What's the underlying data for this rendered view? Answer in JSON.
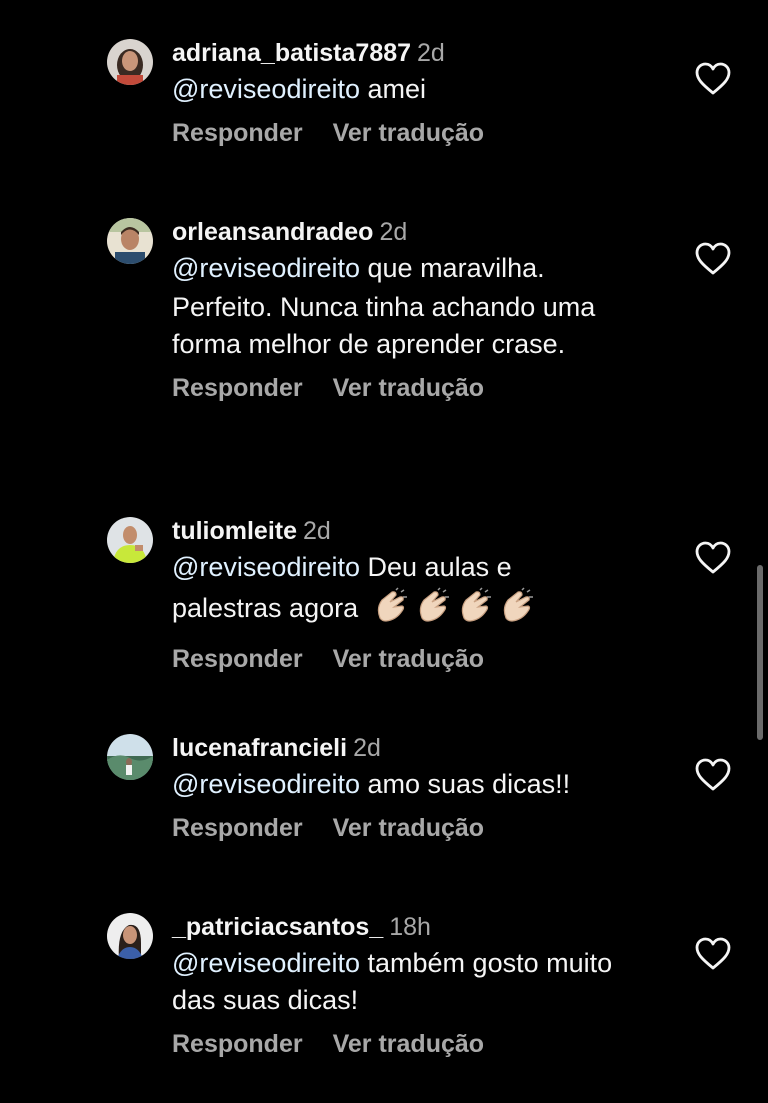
{
  "comments": [
    {
      "username": "adriana_batista7887",
      "time": "2d",
      "mention": "@reviseodireito",
      "text": "amei",
      "reply_label": "Responder",
      "translate_label": "Ver tradução"
    },
    {
      "username": "orleansandradeo",
      "time": "2d",
      "mention": "@reviseodireito",
      "text": "que maravilha.",
      "text2": "Perfeito. Nunca tinha achando uma forma melhor de aprender crase.",
      "reply_label": "Responder",
      "translate_label": "Ver tradução"
    },
    {
      "username": "tuliomleite",
      "time": "2d",
      "mention": "@reviseodireito",
      "text": "Deu aulas e palestras agora",
      "emoji": "👏🏻👏🏻👏🏻👏🏻",
      "reply_label": "Responder",
      "translate_label": "Ver tradução"
    },
    {
      "username": "lucenafrancieli",
      "time": "2d",
      "mention": "@reviseodireito",
      "text": "amo suas dicas!!",
      "reply_label": "Responder",
      "translate_label": "Ver tradução"
    },
    {
      "username": "_patriciacsantos_",
      "time": "18h",
      "mention": "@reviseodireito",
      "text": "também gosto muito das suas dicas!",
      "reply_label": "Responder",
      "translate_label": "Ver tradução"
    }
  ],
  "icons": {
    "like": "heart-outline-icon",
    "clap": "clapping-hands-icon"
  },
  "colors": {
    "background": "#000000",
    "primary_text": "#f5f5f5",
    "secondary_text": "#a8a8a8",
    "mention": "#e0f1ff"
  }
}
